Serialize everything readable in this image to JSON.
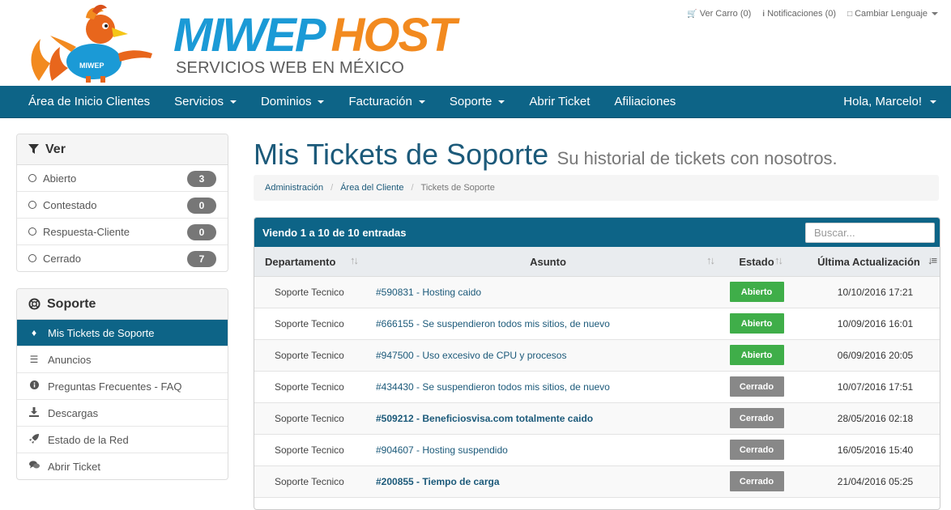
{
  "header": {
    "brand_part1": "MIWEP",
    "brand_part2": "HOST",
    "tagline": "SERVICIOS WEB EN MÉXICO",
    "mascot_shirt_text": "MIWEP",
    "top_links": [
      {
        "label": "Ver Carro (0)",
        "icon": "cart-icon"
      },
      {
        "label": "Notificaciones (0)",
        "icon": "info-icon"
      },
      {
        "label": "Cambiar Lenguaje",
        "icon": "language-icon"
      }
    ]
  },
  "navbar": {
    "items": [
      {
        "label": "Área de Inicio Clientes",
        "dropdown": false
      },
      {
        "label": "Servicios",
        "dropdown": true
      },
      {
        "label": "Dominios",
        "dropdown": true
      },
      {
        "label": "Facturación",
        "dropdown": true
      },
      {
        "label": "Soporte",
        "dropdown": true
      },
      {
        "label": "Abrir Ticket",
        "dropdown": false
      },
      {
        "label": "Afiliaciones",
        "dropdown": false
      }
    ],
    "user_label": "Hola, Marcelo!"
  },
  "sidebar": {
    "filter_panel": {
      "title": "Ver",
      "icon": "filter-icon",
      "items": [
        {
          "label": "Abierto",
          "count": "3"
        },
        {
          "label": "Contestado",
          "count": "0"
        },
        {
          "label": "Respuesta-Cliente",
          "count": "0"
        },
        {
          "label": "Cerrado",
          "count": "7"
        }
      ]
    },
    "support_panel": {
      "title": "Soporte",
      "icon": "lifebuoy-icon",
      "items": [
        {
          "label": "Mis Tickets de Soporte",
          "icon": "ticket-icon",
          "active": true
        },
        {
          "label": "Anuncios",
          "icon": "list-icon",
          "active": false
        },
        {
          "label": "Preguntas Frecuentes - FAQ",
          "icon": "info-circle-icon",
          "active": false
        },
        {
          "label": "Descargas",
          "icon": "download-icon",
          "active": false
        },
        {
          "label": "Estado de la Red",
          "icon": "rocket-icon",
          "active": false
        },
        {
          "label": "Abrir Ticket",
          "icon": "comments-icon",
          "active": false
        }
      ]
    }
  },
  "main": {
    "title": "Mis Tickets de Soporte",
    "subtitle": "Su historial de tickets con nosotros.",
    "breadcrumbs": [
      "Administración",
      "Área del Cliente",
      "Tickets de Soporte"
    ],
    "table": {
      "info": "Viendo 1 a 10 de 10 entradas",
      "search_placeholder": "Buscar...",
      "columns": [
        "Departamento",
        "Asunto",
        "Estado",
        "Última Actualización"
      ],
      "rows": [
        {
          "dept": "Soporte Tecnico",
          "subject": "#590831 - Hosting caido",
          "status": "Abierto",
          "updated": "10/10/2016 17:21",
          "bold": false
        },
        {
          "dept": "Soporte Tecnico",
          "subject": "#666155 - Se suspendieron todos mis sitios, de nuevo",
          "status": "Abierto",
          "updated": "10/09/2016 16:01",
          "bold": false
        },
        {
          "dept": "Soporte Tecnico",
          "subject": "#947500 - Uso excesivo de CPU y procesos",
          "status": "Abierto",
          "updated": "06/09/2016 20:05",
          "bold": false
        },
        {
          "dept": "Soporte Tecnico",
          "subject": "#434430 - Se suspendieron todos mis sitios, de nuevo",
          "status": "Cerrado",
          "updated": "10/07/2016 17:51",
          "bold": false
        },
        {
          "dept": "Soporte Tecnico",
          "subject": "#509212 - Beneficiosvisa.com totalmente caido",
          "status": "Cerrado",
          "updated": "28/05/2016 02:18",
          "bold": true
        },
        {
          "dept": "Soporte Tecnico",
          "subject": "#904607 - Hosting suspendido",
          "status": "Cerrado",
          "updated": "16/05/2016 15:40",
          "bold": false
        },
        {
          "dept": "Soporte Tecnico",
          "subject": "#200855 - Tiempo de carga",
          "status": "Cerrado",
          "updated": "21/04/2016 05:25",
          "bold": true
        }
      ]
    }
  },
  "colors": {
    "primary": "#0d6487",
    "brand_blue": "#1b9ad6",
    "brand_orange": "#f28a1f",
    "status_open": "#3fae49",
    "status_closed": "#888888",
    "link": "#1c5a7a"
  }
}
